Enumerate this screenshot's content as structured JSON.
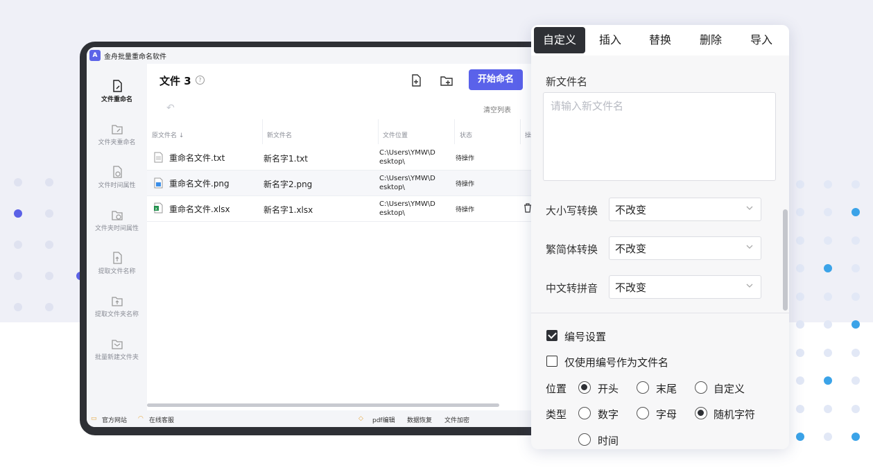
{
  "app": {
    "title": "金舟批量重命名软件"
  },
  "sidebar": {
    "items": [
      {
        "label": "文件重命名",
        "icon": "file-rename-icon",
        "active": true
      },
      {
        "label": "文件夹重命名",
        "icon": "folder-rename-icon"
      },
      {
        "label": "文件时间属性",
        "icon": "file-time-icon"
      },
      {
        "label": "文件夹时间属性",
        "icon": "folder-time-icon"
      },
      {
        "label": "提取文件名称",
        "icon": "extract-file-icon"
      },
      {
        "label": "提取文件夹名称",
        "icon": "extract-folder-icon"
      },
      {
        "label": "批量新建文件夹",
        "icon": "new-folder-icon"
      }
    ]
  },
  "main": {
    "title": "文件 3",
    "start_button": "开始命名",
    "clear_list": "清空列表",
    "columns": [
      "原文件名 ↓",
      "新文件名",
      "文件位置",
      "状态",
      "操"
    ],
    "rows": [
      {
        "original": "重命名文件.txt",
        "new_name": "新名字1.txt",
        "path": "C:\\Users\\YMW\\D esktop\\",
        "status": "待操作",
        "icon": "txt-file-icon"
      },
      {
        "original": "重命名文件.png",
        "new_name": "新名字2.png",
        "path": "C:\\Users\\YMW\\D esktop\\",
        "status": "待操作",
        "icon": "png-file-icon"
      },
      {
        "original": "重命名文件.xlsx",
        "new_name": "新名字1.xlsx",
        "path": "C:\\Users\\YMW\\D esktop\\",
        "status": "待操作",
        "icon": "xlsx-file-icon"
      }
    ]
  },
  "statusbar": {
    "website": "官方网站",
    "service": "在线客服",
    "pdf": "pdf编辑",
    "recover": "数据恢复",
    "encrypt": "文件加密"
  },
  "panel": {
    "tabs": [
      "自定义",
      "插入",
      "替换",
      "删除",
      "导入"
    ],
    "new_name_label": "新文件名",
    "new_name_placeholder": "请输入新文件名",
    "case_label": "大小写转换",
    "case_value": "不改变",
    "trad_label": "繁简体转换",
    "trad_value": "不改变",
    "pinyin_label": "中文转拼音",
    "pinyin_value": "不改变",
    "numbering_label": "编号设置",
    "numbering_checked": true,
    "only_number_label": "仅使用编号作为文件名",
    "only_number_checked": false,
    "position_label": "位置",
    "position_options": [
      "开头",
      "末尾",
      "自定义"
    ],
    "position_selected": "开头",
    "type_label": "类型",
    "type_options": [
      "数字",
      "字母",
      "随机字符",
      "时间"
    ],
    "type_selected": "随机字符"
  },
  "colors": {
    "accent": "#5a62ea",
    "dark": "#2e3035",
    "dot_purple": "#5b61e6",
    "dot_blue": "#3ba3e8"
  }
}
